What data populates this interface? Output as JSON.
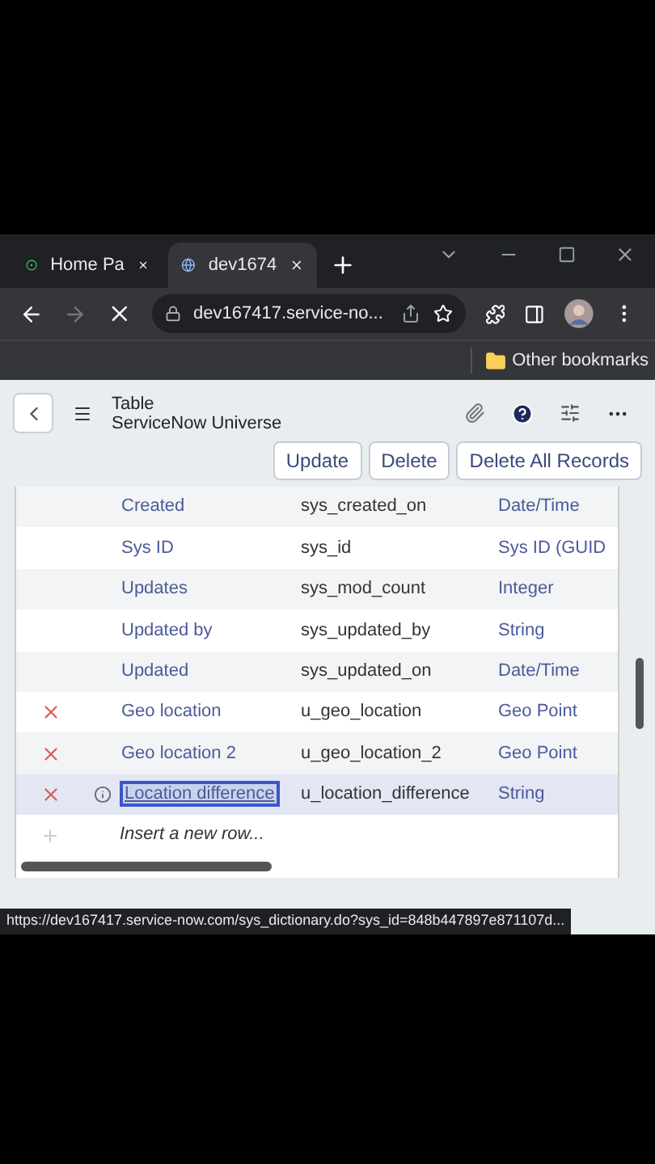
{
  "browser": {
    "tabs": [
      {
        "title": "Home Pa",
        "selected": false
      },
      {
        "title": "dev1674",
        "selected": true
      }
    ],
    "address": "dev167417.service-no...",
    "loading": true,
    "bookmarks": [
      {
        "label": "Other bookmarks"
      }
    ]
  },
  "header": {
    "title": "Table",
    "subtitle": "ServiceNow Universe",
    "buttons": [
      "Update",
      "Delete",
      "Delete All Records"
    ]
  },
  "table": {
    "rows": [
      {
        "label": "Created",
        "column_name": "sys_created_on",
        "type": "Date/Time",
        "removable": false,
        "selected": false
      },
      {
        "label": "Sys ID",
        "column_name": "sys_id",
        "type": "Sys ID (GUID",
        "removable": false,
        "selected": false
      },
      {
        "label": "Updates",
        "column_name": "sys_mod_count",
        "type": "Integer",
        "removable": false,
        "selected": false
      },
      {
        "label": "Updated by",
        "column_name": "sys_updated_by",
        "type": "String",
        "removable": false,
        "selected": false
      },
      {
        "label": "Updated",
        "column_name": "sys_updated_on",
        "type": "Date/Time",
        "removable": false,
        "selected": false
      },
      {
        "label": "Geo location",
        "column_name": "u_geo_location",
        "type": "Geo Point",
        "removable": true,
        "selected": false
      },
      {
        "label": "Geo location 2",
        "column_name": "u_geo_location_2",
        "type": "Geo Point",
        "removable": true,
        "selected": false
      },
      {
        "label": "Location difference",
        "column_name": "u_location_difference",
        "type": "String",
        "removable": true,
        "selected": true
      }
    ],
    "insert_row": "Insert a new row..."
  },
  "status_url": "https://dev167417.service-now.com/sys_dictionary.do?sys_id=848b447897e871107d..."
}
